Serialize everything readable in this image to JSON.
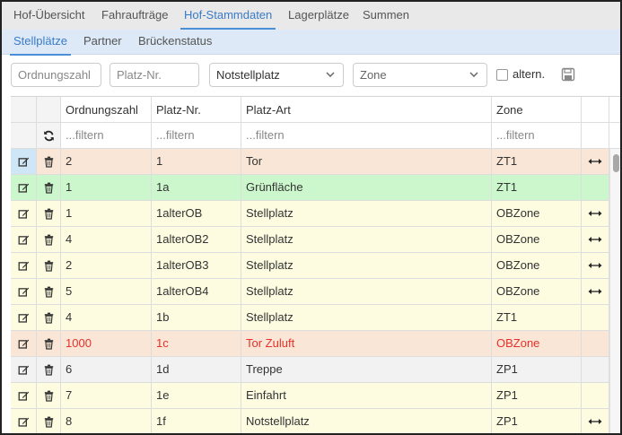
{
  "main_tabs": [
    "Hof-Übersicht",
    "Fahraufträge",
    "Hof-Stammdaten",
    "Lagerplätze",
    "Summen"
  ],
  "sub_tabs": [
    "Stellplätze",
    "Partner",
    "Brückenstatus"
  ],
  "filters": {
    "ordnungszahl_placeholder": "Ordnungszahl",
    "platznr_placeholder": "Platz-Nr.",
    "platzart_selected": "Notstellplatz",
    "zone_selected": "Zone",
    "altern_label": "altern.",
    "altern_checked": false
  },
  "table": {
    "headers": [
      "Ordnungszahl",
      "Platz-Nr.",
      "Platz-Art",
      "Zone"
    ],
    "filter_placeholder": "...filtern",
    "rows": [
      {
        "ordnungszahl": "2",
        "platznr": "1",
        "platzart": "Tor",
        "zone": "ZT1",
        "highlight": "#f9e6d6",
        "arrow": true,
        "alert": false
      },
      {
        "ordnungszahl": "1",
        "platznr": "1a",
        "platzart": "Grünfläche",
        "zone": "ZT1",
        "highlight": "#ccf7cc",
        "arrow": false,
        "alert": false
      },
      {
        "ordnungszahl": "1",
        "platznr": "1alterOB",
        "platzart": "Stellplatz",
        "zone": "OBZone",
        "highlight": "#fdfbe0",
        "arrow": true,
        "alert": false
      },
      {
        "ordnungszahl": "4",
        "platznr": "1alterOB2",
        "platzart": "Stellplatz",
        "zone": "OBZone",
        "highlight": "#fdfbe0",
        "arrow": true,
        "alert": false
      },
      {
        "ordnungszahl": "2",
        "platznr": "1alterOB3",
        "platzart": "Stellplatz",
        "zone": "OBZone",
        "highlight": "#fdfbe0",
        "arrow": true,
        "alert": false
      },
      {
        "ordnungszahl": "5",
        "platznr": "1alterOB4",
        "platzart": "Stellplatz",
        "zone": "OBZone",
        "highlight": "#fdfbe0",
        "arrow": true,
        "alert": false
      },
      {
        "ordnungszahl": "4",
        "platznr": "1b",
        "platzart": "Stellplatz",
        "zone": "ZT1",
        "highlight": "#fdfbe0",
        "arrow": false,
        "alert": false
      },
      {
        "ordnungszahl": "1000",
        "platznr": "1c",
        "platzart": "Tor Zuluft",
        "zone": "OBZone",
        "highlight": "#f9e6d6",
        "arrow": false,
        "alert": true
      },
      {
        "ordnungszahl": "6",
        "platznr": "1d",
        "platzart": "Treppe",
        "zone": "ZP1",
        "highlight": "#f2f2f2",
        "arrow": false,
        "alert": false
      },
      {
        "ordnungszahl": "7",
        "platznr": "1e",
        "platzart": "Einfahrt",
        "zone": "ZP1",
        "highlight": "#fdfbe0",
        "arrow": false,
        "alert": false
      },
      {
        "ordnungszahl": "8",
        "platznr": "1f",
        "platzart": "Notstellplatz",
        "zone": "ZP1",
        "highlight": "#fdfbe0",
        "arrow": true,
        "alert": false
      }
    ]
  },
  "colors": {
    "accent": "#3a7bc8",
    "alert_text": "#e8302a",
    "edit_icon": "#333333",
    "selected_icon_bg": "#cfe6f7"
  },
  "icons": {
    "edit": "edit-icon",
    "delete": "trash-icon",
    "refresh": "refresh-icon",
    "link": "double-arrow-icon",
    "save": "save-icon",
    "dropdown": "chevron-down-icon"
  }
}
